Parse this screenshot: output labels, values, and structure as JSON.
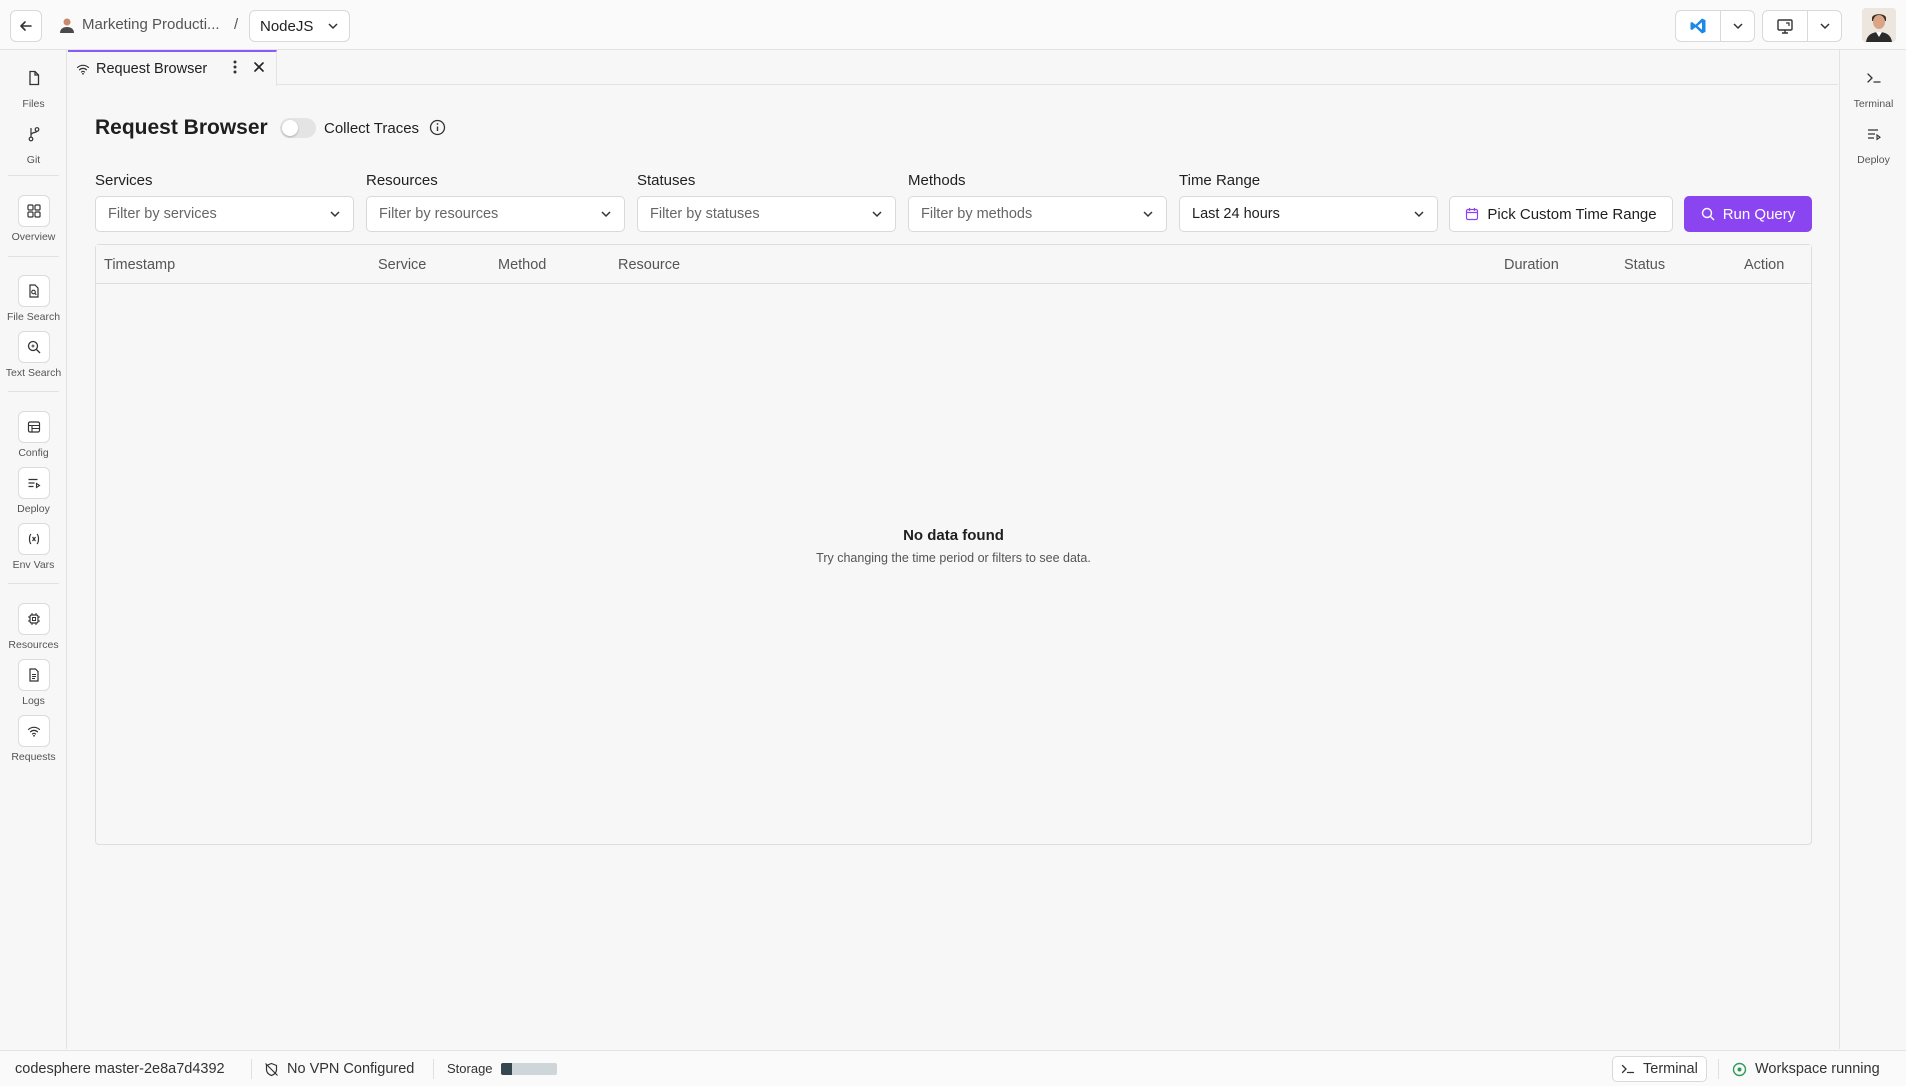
{
  "topbar": {
    "project_name": "Marketing Producti...",
    "separator": "/",
    "environment": "NodeJS"
  },
  "left_rail": {
    "files": "Files",
    "git": "Git",
    "overview": "Overview",
    "file_search": "File Search",
    "text_search": "Text Search",
    "config": "Config",
    "deploy": "Deploy",
    "env_vars": "Env Vars",
    "resources": "Resources",
    "logs": "Logs",
    "requests": "Requests"
  },
  "right_rail": {
    "terminal": "Terminal",
    "deploy": "Deploy"
  },
  "tab": {
    "label": "Request Browser"
  },
  "page": {
    "title": "Request Browser",
    "collect_traces_label": "Collect Traces",
    "collect_traces_on": false
  },
  "filters": {
    "services": {
      "label": "Services",
      "placeholder": "Filter by services"
    },
    "resources": {
      "label": "Resources",
      "placeholder": "Filter by resources"
    },
    "statuses": {
      "label": "Statuses",
      "placeholder": "Filter by statuses"
    },
    "methods": {
      "label": "Methods",
      "placeholder": "Filter by methods"
    },
    "time_range": {
      "label": "Time Range",
      "value": "Last 24 hours"
    },
    "custom_range_button": "Pick Custom Time Range",
    "run_query_button": "Run Query"
  },
  "table": {
    "columns": [
      "Timestamp",
      "Service",
      "Method",
      "Resource",
      "Duration",
      "Status",
      "Action"
    ],
    "rows": [],
    "empty_title": "No data found",
    "empty_subtitle": "Try changing the time period or filters to see data."
  },
  "statusbar": {
    "workspace": "codesphere master-2e8a7d4392",
    "vpn": "No VPN Configured",
    "storage_label": "Storage",
    "storage_used_fraction": 0.2,
    "terminal_button": "Terminal",
    "workspace_status": "Workspace running"
  },
  "colors": {
    "accent": "#8b45f0",
    "running": "#2e9b5a"
  }
}
